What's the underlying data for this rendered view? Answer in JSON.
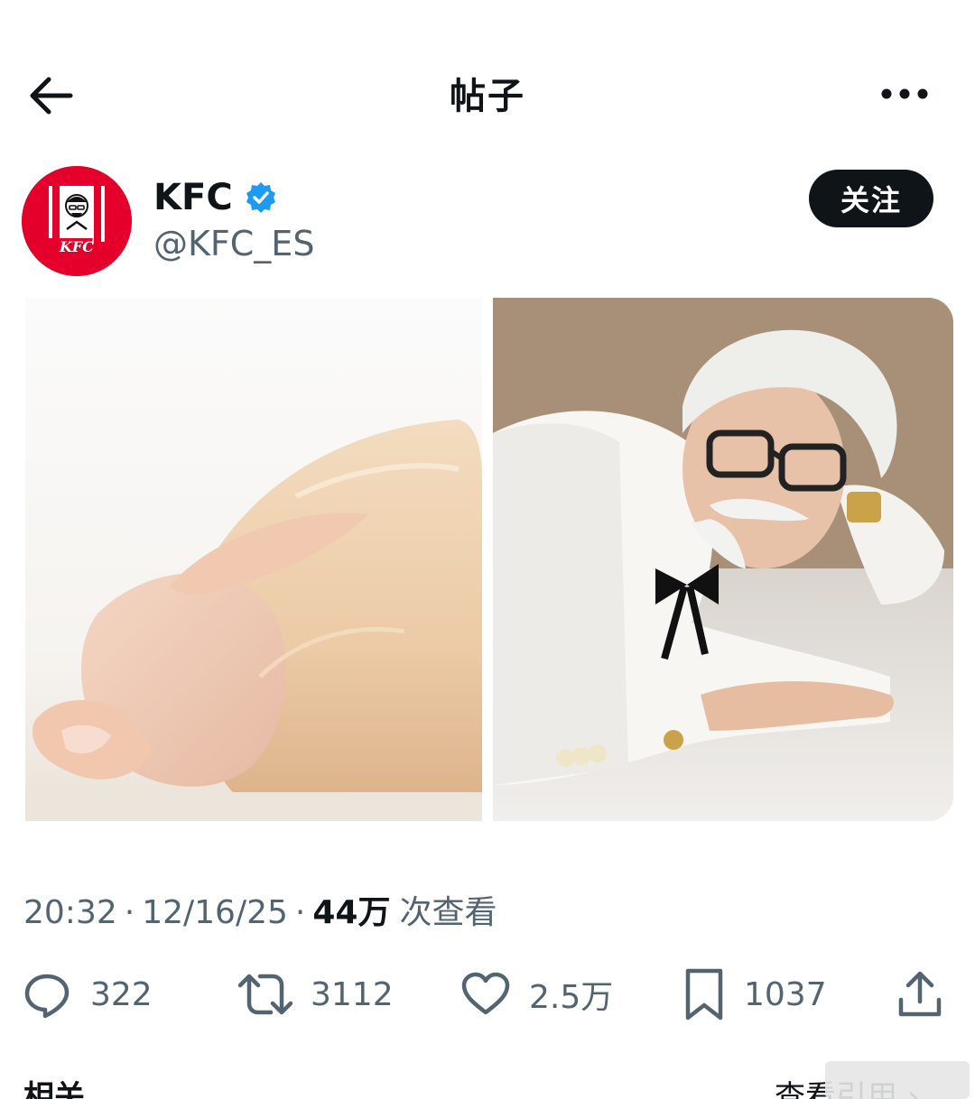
{
  "header": {
    "title": "帖子",
    "back_icon": "arrow-left-icon",
    "more_icon": "more-horizontal-icon"
  },
  "author": {
    "name": "KFC",
    "handle": "@KFC_ES",
    "verified_icon": "verified-badge-icon",
    "verified_color": "#1d9bf0",
    "brand_color": "#e4002b",
    "avatar_text": "KFC",
    "follow_label": "关注"
  },
  "meta": {
    "time": "20:32",
    "date": "12/16/25",
    "views": "44万",
    "views_label": "次查看"
  },
  "actions": {
    "replies": "322",
    "reposts": "3112",
    "likes": "2.5万",
    "bookmarks": "1037"
  },
  "footer": {
    "related_label": "相关",
    "quotes_label": "查看引用"
  }
}
